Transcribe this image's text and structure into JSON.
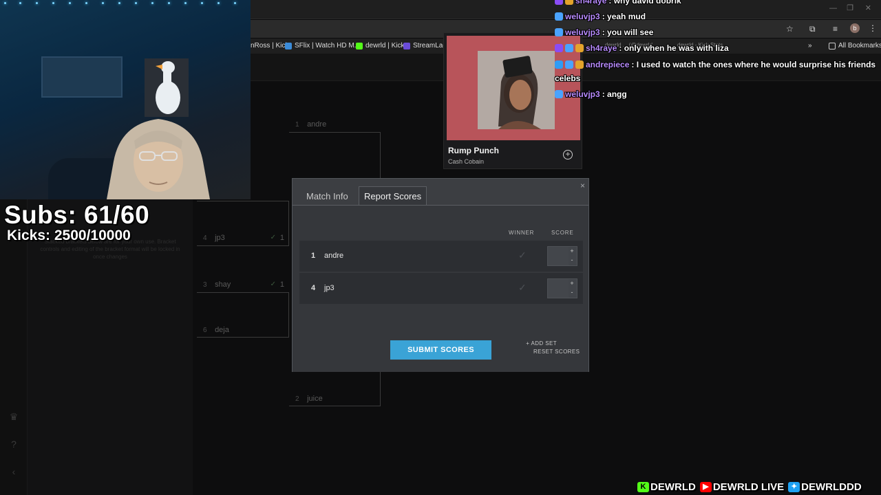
{
  "browser": {
    "bookmarks": [
      {
        "label": "nRoss | Kick",
        "color": "#3a3a3a"
      },
      {
        "label": "SFlix | Watch HD M...",
        "color": "#3b8bd8"
      },
      {
        "label": "dewrld | Kick",
        "color": "#53fc18"
      },
      {
        "label": "StreamLadde",
        "color": "#6a4cd8"
      }
    ],
    "all_bookmarks": "All Bookmarks",
    "extra_bookmarks": [
      "dewrld ... (@dewrld",
      "dewrld - Kick Stats"
    ],
    "profile_initial": "b"
  },
  "stream": {
    "subs": "Subs: 61/60",
    "kicks": "Kicks: 2500/10000"
  },
  "now_playing": {
    "title": "Rump Punch",
    "artist": "Cash Cobain"
  },
  "chat": [
    {
      "user": "sh4raye",
      "message": ": why david dobrik",
      "badge_color": "#8a4cf5"
    },
    {
      "user": "weluvjp3",
      "message": ": yeah mud",
      "badge_color": "#4aa3ff"
    },
    {
      "user": "weluvjp3",
      "message": ": you will see",
      "badge_color": "#4aa3ff"
    },
    {
      "user": "sh4raye",
      "message": ": only when he was with liza",
      "badge_color": "#8a4cf5"
    },
    {
      "user": "andrepiece",
      "message": ": I used to watch the ones where he would surprise his friends",
      "badge_color": "#2f9cf5"
    },
    {
      "user": "",
      "message": "celebs",
      "badge_color": ""
    },
    {
      "user": "weluvjp3",
      "message": ": angg",
      "badge_color": "#4aa3ff"
    }
  ],
  "bracket": {
    "slots": [
      {
        "seed": "1",
        "name": "andre",
        "score": ""
      },
      {
        "seed": "4",
        "name": "jp3",
        "score": "1"
      },
      {
        "seed": "3",
        "name": "shay",
        "score": "1"
      },
      {
        "seed": "6",
        "name": "deja",
        "score": ""
      },
      {
        "seed": "2",
        "name": "juice",
        "score": ""
      }
    ],
    "sidebar_note": "Stacked brackets below are for your own use. Bracket controls and editing of the bracket format will be locked in once changes"
  },
  "modal": {
    "tabs": [
      "Match Info",
      "Report Scores"
    ],
    "active_tab": "Report Scores",
    "close": "×",
    "col_winner": "WINNER",
    "col_score": "SCORE",
    "participants": [
      {
        "seed": "1",
        "name": "andre",
        "score": ""
      },
      {
        "seed": "4",
        "name": "jp3",
        "score": ""
      }
    ],
    "add_set": "+ ADD SET",
    "submit": "SUBMIT SCORES",
    "reset": "RESET SCORES"
  },
  "socials": {
    "kick": "DEWRLD",
    "youtube": "DEWRLD LIVE",
    "twitter": "DEWRLDDD"
  },
  "colors": {
    "accent": "#3aa3d6",
    "kick_green": "#53fc18",
    "youtube_red": "#ff0000",
    "twitter_blue": "#1da1f2",
    "chat_username": "#b98cff"
  }
}
